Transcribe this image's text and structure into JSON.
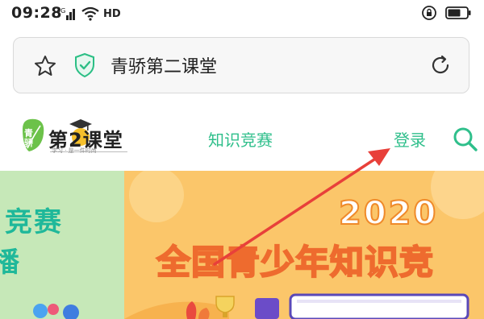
{
  "status_bar": {
    "time": "09:28",
    "network": "4G",
    "hd": "HD"
  },
  "url_bar": {
    "title": "青骄第二课堂"
  },
  "site_header": {
    "logo_text": "第2课堂",
    "logo_badge": "青骄",
    "logo_slogan": "学习 · 是一件时尚",
    "nav_contest": "知识竞赛",
    "nav_login": "登录"
  },
  "banner_left": {
    "text_line1": "竞赛",
    "text_line2": "播"
  },
  "banner_main": {
    "year": "2020",
    "headline": "全国青少年知识竞"
  },
  "colors": {
    "accent_green": "#2fbf8b",
    "banner_orange": "#fbc66a",
    "arrow_red": "#e8403a"
  }
}
